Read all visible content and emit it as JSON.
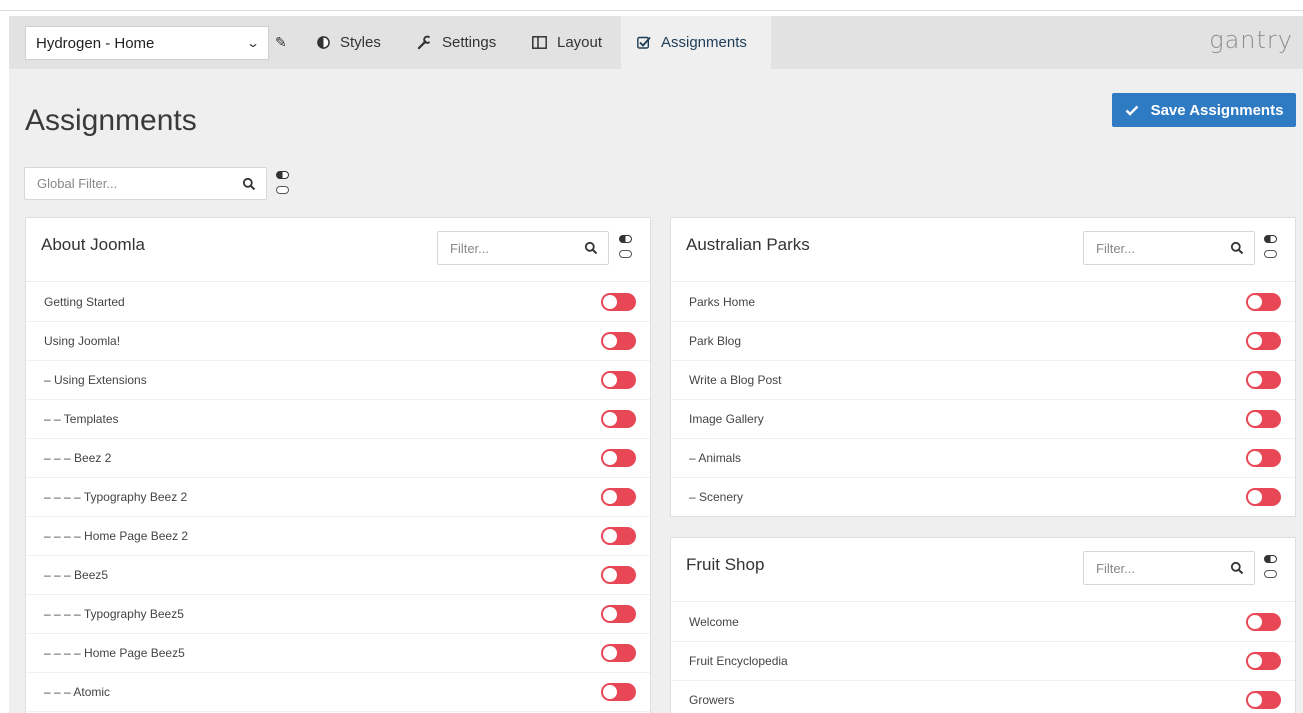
{
  "topbar": {
    "outline_selected": "Hydrogen - Home",
    "nav": [
      {
        "label": "Styles",
        "icon": "half-circle-icon"
      },
      {
        "label": "Settings",
        "icon": "wrench-icon"
      },
      {
        "label": "Layout",
        "icon": "layout-columns-icon"
      },
      {
        "label": "Assignments",
        "icon": "checkbox-icon",
        "active": true
      }
    ],
    "brand": "gantry"
  },
  "page": {
    "title": "Assignments",
    "save_label": "Save Assignments",
    "global_filter_placeholder": "Global Filter..."
  },
  "panels": [
    {
      "title": "About Joomla",
      "filter_placeholder": "Filter...",
      "items": [
        "Getting Started",
        "Using Joomla!",
        "– Using Extensions",
        "– – Templates",
        "– – – Beez 2",
        "– – – – Typography Beez 2",
        "– – – – Home Page Beez 2",
        "– – – Beez5",
        "– – – – Typography Beez5",
        "– – – – Home Page Beez5",
        "– – – Atomic"
      ]
    },
    {
      "title": "Australian Parks",
      "filter_placeholder": "Filter...",
      "items": [
        "Parks Home",
        "Park Blog",
        "Write a Blog Post",
        "Image Gallery",
        "– Animals",
        "– Scenery"
      ]
    },
    {
      "title": "Fruit Shop",
      "filter_placeholder": "Filter...",
      "items": [
        "Welcome",
        "Fruit Encyclopedia",
        "Growers"
      ]
    }
  ],
  "colors": {
    "toggle_off": "#e84756",
    "primary": "#2e7bc4",
    "active_nav_text": "#1e3d58"
  }
}
